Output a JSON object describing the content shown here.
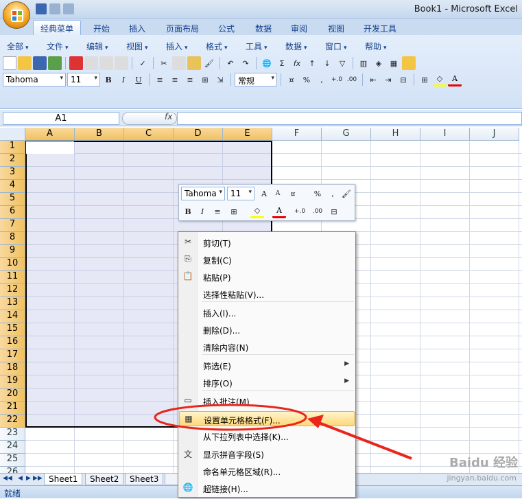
{
  "window": {
    "title": "Book1 - Microsoft Excel"
  },
  "tabs": [
    "经典菜单",
    "开始",
    "插入",
    "页面布局",
    "公式",
    "数据",
    "审阅",
    "视图",
    "开发工具"
  ],
  "classic_menu": [
    "全部",
    "文件",
    "编辑",
    "视图",
    "插入",
    "格式",
    "工具",
    "数据",
    "窗口",
    "帮助"
  ],
  "toolbar": {
    "font": "Tahoma",
    "size": "11",
    "number_format": "常规",
    "bold": "B",
    "italic": "I",
    "underline": "U",
    "percent": "%",
    "comma": ",",
    "inc_dec": ".00"
  },
  "formula_bar": {
    "name_box": "A1",
    "fx": "fx",
    "value": ""
  },
  "columns": [
    "A",
    "B",
    "C",
    "D",
    "E",
    "F",
    "G",
    "H",
    "I",
    "J"
  ],
  "rows": [
    "1",
    "2",
    "3",
    "4",
    "5",
    "6",
    "7",
    "8",
    "9",
    "10",
    "11",
    "12",
    "13",
    "14",
    "15",
    "16",
    "17",
    "18",
    "19",
    "20",
    "21",
    "22",
    "23",
    "24",
    "25",
    "26"
  ],
  "mini_toolbar": {
    "font": "Tahoma",
    "size": "11",
    "percent": "%",
    "comma": ",",
    "bold": "B",
    "italic": "I"
  },
  "context_menu": [
    {
      "label": "剪切(T)",
      "icon": "scissors-icon",
      "glyph": "✂"
    },
    {
      "label": "复制(C)",
      "icon": "copy-icon",
      "glyph": "⎘"
    },
    {
      "label": "粘贴(P)",
      "icon": "paste-icon",
      "glyph": "📋"
    },
    {
      "label": "选择性粘贴(V)...",
      "icon": "",
      "glyph": ""
    },
    {
      "label": "插入(I)...",
      "icon": "",
      "glyph": ""
    },
    {
      "label": "删除(D)...",
      "icon": "",
      "glyph": ""
    },
    {
      "label": "清除内容(N)",
      "icon": "",
      "glyph": ""
    },
    {
      "label": "筛选(E)",
      "icon": "",
      "glyph": "",
      "submenu": true
    },
    {
      "label": "排序(O)",
      "icon": "",
      "glyph": "",
      "submenu": true
    },
    {
      "label": "插入批注(M)",
      "icon": "comment-icon",
      "glyph": "▭"
    },
    {
      "label": "设置单元格格式(F)...",
      "icon": "format-cells-icon",
      "glyph": "▦",
      "highlight": true
    },
    {
      "label": "从下拉列表中选择(K)...",
      "icon": "",
      "glyph": ""
    },
    {
      "label": "显示拼音字段(S)",
      "icon": "phonetic-icon",
      "glyph": "文"
    },
    {
      "label": "命名单元格区域(R)...",
      "icon": "",
      "glyph": ""
    },
    {
      "label": "超链接(H)...",
      "icon": "hyperlink-icon",
      "glyph": "🌐"
    }
  ],
  "sheets": [
    "Sheet1",
    "Sheet2",
    "Sheet3"
  ],
  "status": "就绪",
  "watermark": {
    "text": "Baidu 经验",
    "url": "jingyan.baidu.com"
  }
}
